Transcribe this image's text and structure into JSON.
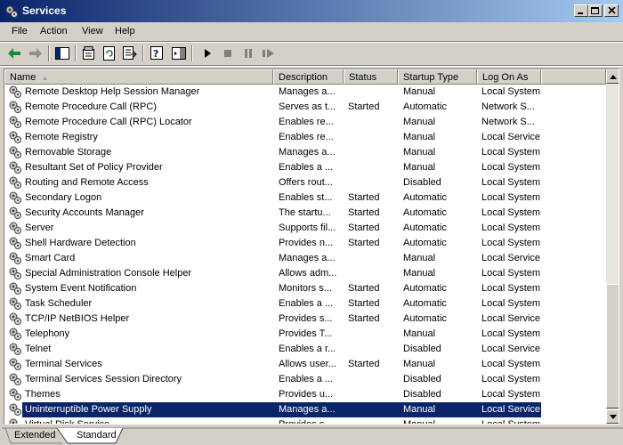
{
  "window": {
    "title": "Services"
  },
  "menu": [
    "File",
    "Action",
    "View",
    "Help"
  ],
  "columns": {
    "name": "Name",
    "description": "Description",
    "status": "Status",
    "startup_type": "Startup Type",
    "log_on_as": "Log On As"
  },
  "rows": [
    {
      "name": "Remote Desktop Help Session Manager",
      "description": "Manages a...",
      "status": "",
      "startup": "Manual",
      "logon": "Local System"
    },
    {
      "name": "Remote Procedure Call (RPC)",
      "description": "Serves as t...",
      "status": "Started",
      "startup": "Automatic",
      "logon": "Network S..."
    },
    {
      "name": "Remote Procedure Call (RPC) Locator",
      "description": "Enables re...",
      "status": "",
      "startup": "Manual",
      "logon": "Network S..."
    },
    {
      "name": "Remote Registry",
      "description": "Enables re...",
      "status": "",
      "startup": "Manual",
      "logon": "Local Service"
    },
    {
      "name": "Removable Storage",
      "description": "Manages a...",
      "status": "",
      "startup": "Manual",
      "logon": "Local System"
    },
    {
      "name": "Resultant Set of Policy Provider",
      "description": "Enables a ...",
      "status": "",
      "startup": "Manual",
      "logon": "Local System"
    },
    {
      "name": "Routing and Remote Access",
      "description": "Offers rout...",
      "status": "",
      "startup": "Disabled",
      "logon": "Local System"
    },
    {
      "name": "Secondary Logon",
      "description": "Enables st...",
      "status": "Started",
      "startup": "Automatic",
      "logon": "Local System"
    },
    {
      "name": "Security Accounts Manager",
      "description": "The startu...",
      "status": "Started",
      "startup": "Automatic",
      "logon": "Local System"
    },
    {
      "name": "Server",
      "description": "Supports fil...",
      "status": "Started",
      "startup": "Automatic",
      "logon": "Local System"
    },
    {
      "name": "Shell Hardware Detection",
      "description": "Provides n...",
      "status": "Started",
      "startup": "Automatic",
      "logon": "Local System"
    },
    {
      "name": "Smart Card",
      "description": "Manages a...",
      "status": "",
      "startup": "Manual",
      "logon": "Local Service"
    },
    {
      "name": "Special Administration Console Helper",
      "description": "Allows adm...",
      "status": "",
      "startup": "Manual",
      "logon": "Local System"
    },
    {
      "name": "System Event Notification",
      "description": "Monitors s...",
      "status": "Started",
      "startup": "Automatic",
      "logon": "Local System"
    },
    {
      "name": "Task Scheduler",
      "description": "Enables a ...",
      "status": "Started",
      "startup": "Automatic",
      "logon": "Local System"
    },
    {
      "name": "TCP/IP NetBIOS Helper",
      "description": "Provides s...",
      "status": "Started",
      "startup": "Automatic",
      "logon": "Local Service"
    },
    {
      "name": "Telephony",
      "description": "Provides T...",
      "status": "",
      "startup": "Manual",
      "logon": "Local System"
    },
    {
      "name": "Telnet",
      "description": "Enables a r...",
      "status": "",
      "startup": "Disabled",
      "logon": "Local Service"
    },
    {
      "name": "Terminal Services",
      "description": "Allows user...",
      "status": "Started",
      "startup": "Manual",
      "logon": "Local System"
    },
    {
      "name": "Terminal Services Session Directory",
      "description": "Enables a ...",
      "status": "",
      "startup": "Disabled",
      "logon": "Local System"
    },
    {
      "name": "Themes",
      "description": "Provides u...",
      "status": "",
      "startup": "Disabled",
      "logon": "Local System"
    },
    {
      "name": "Uninterruptible Power Supply",
      "description": "Manages a...",
      "status": "",
      "startup": "Manual",
      "logon": "Local Service",
      "selected": true
    },
    {
      "name": "Virtual Disk Service",
      "description": "Provides s...",
      "status": "",
      "startup": "Manual",
      "logon": "Local System"
    }
  ],
  "tabs": [
    "Extended",
    "Standard"
  ],
  "toolbar_icons": [
    "back-arrow-icon",
    "forward-arrow-icon",
    "show-hide-tree-icon",
    "properties-icon",
    "refresh-icon",
    "export-list-icon",
    "help-icon",
    "console-tree-icon",
    "start-service-icon",
    "stop-service-icon",
    "pause-service-icon",
    "restart-service-icon"
  ],
  "colors": {
    "selection": "#0a246a",
    "title_start": "#0a246a",
    "title_end": "#a6caf0",
    "face": "#d4d0c8"
  }
}
